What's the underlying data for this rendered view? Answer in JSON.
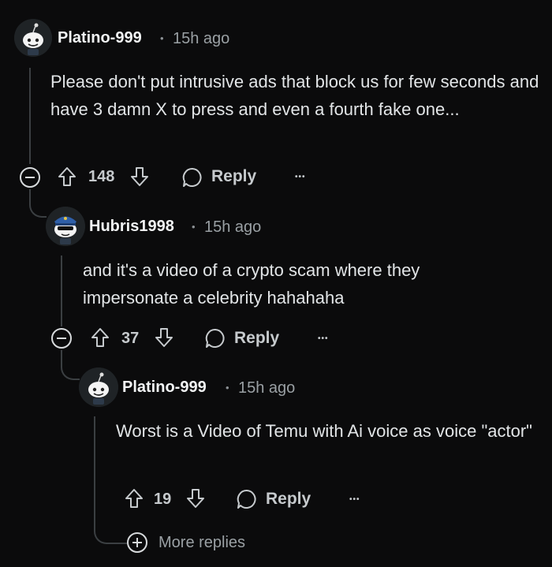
{
  "comments": [
    {
      "username": "Platino-999",
      "separator": "•",
      "time": "15h ago",
      "text": "Please don't put intrusive ads that block us for few seconds and have 3 damn X to press and even a fourth fake one...",
      "votes": "148",
      "reply_label": "Reply",
      "more_label": "•••"
    },
    {
      "username": "Hubris1998",
      "separator": "•",
      "time": "15h ago",
      "text": "and it's a video of a crypto scam where they impersonate a celebrity hahahaha",
      "votes": "37",
      "reply_label": "Reply",
      "more_label": "•••"
    },
    {
      "username": "Platino-999",
      "separator": "•",
      "time": "15h ago",
      "text": "Worst is a Video of Temu with Ai voice as voice \"actor\"",
      "votes": "19",
      "reply_label": "Reply",
      "more_label": "•••"
    }
  ],
  "more_replies_label": "More replies",
  "icons": {
    "upvote": "upvote-icon",
    "downvote": "downvote-icon",
    "reply": "speech-bubble-icon",
    "collapse": "collapse-icon",
    "expand": "expand-icon"
  },
  "colors": {
    "background": "#0b0b0c",
    "text": "#e2e5e7",
    "muted": "#9aa0a4",
    "thread": "#3b3f42"
  }
}
